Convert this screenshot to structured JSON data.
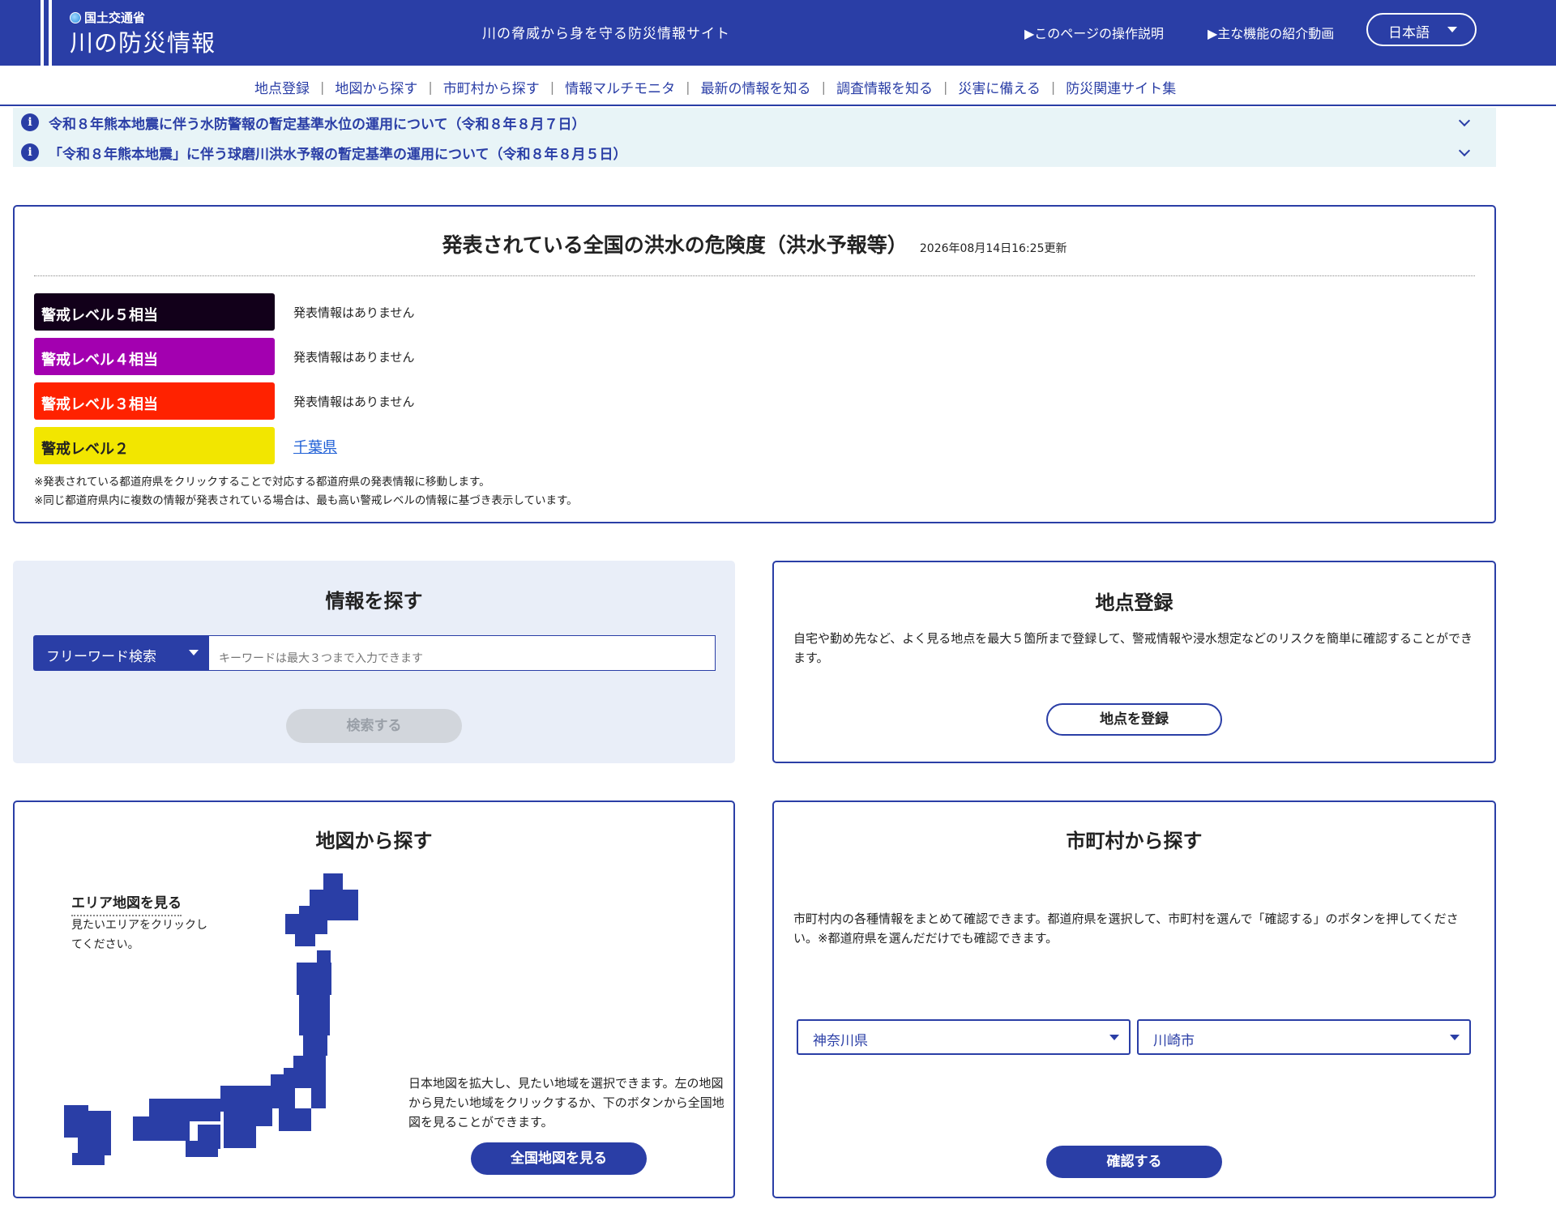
{
  "header": {
    "agency": "国土交通省",
    "site_title": "川の防災情報",
    "tagline": "川の脅威から身を守る防災情報サイト",
    "links": [
      "▶このページの操作説明",
      "▶主な機能の紹介動画"
    ],
    "language": "日本語"
  },
  "nav": {
    "items": [
      "地点登録",
      "地図から探す",
      "市町村から探す",
      "情報マルチモニタ",
      "最新の情報を知る",
      "調査情報を知る",
      "災害に備える",
      "防災関連サイト集"
    ]
  },
  "notices": [
    "令和８年熊本地震に伴う水防警報の暫定基準水位の運用について（令和８年８月７日）",
    "「令和８年熊本地震」に伴う球磨川洪水予報の暫定基準の運用について（令和８年８月５日）"
  ],
  "flood": {
    "title": "発表されている全国の洪水の危険度（洪水予報等）",
    "updated": "2026年08月14日16:25更新",
    "levels": [
      {
        "label": "警戒レベル５相当",
        "status": "発表情報はありません",
        "color": "#12001a"
      },
      {
        "label": "警戒レベル４相当",
        "status": "発表情報はありません",
        "color": "#a300b0"
      },
      {
        "label": "警戒レベル３相当",
        "status": "発表情報はありません",
        "color": "#ff2200"
      },
      {
        "label": "警戒レベル２",
        "status": "千葉県",
        "color": "#f2e600"
      }
    ],
    "notes": [
      "※発表されている都道府県をクリックすることで対応する都道府県の発表情報に移動します。",
      "※同じ都道府県内に複数の情報が発表されている場合は、最も高い警戒レベルの情報に基づき表示しています。"
    ]
  },
  "search": {
    "title": "情報を探す",
    "mode": "フリーワード検索",
    "placeholder": "キーワードは最大３つまで入力できます",
    "button": "検索する"
  },
  "register": {
    "title": "地点登録",
    "description": "自宅や勤め先など、よく見る地点を最大５箇所まで登録して、警戒情報や浸水想定などのリスクを簡単に確認することができます。",
    "button": "地点を登録"
  },
  "map": {
    "title": "地図から探す",
    "area_label": "エリア地図を見る",
    "area_hint": "見たいエリアをクリックしてください。",
    "description": "日本地図を拡大し、見たい地域を選択できます。左の地図から見たい地域をクリックするか、下のボタンから全国地図を見ることができます。",
    "button": "全国地図を見る"
  },
  "municipality": {
    "title": "市町村から探す",
    "description": "市町村内の各種情報をまとめて確認できます。都道府県を選択して、市町村を選んで「確認する」のボタンを押してください。※都道府県を選んだだけでも確認できます。",
    "prefecture": "神奈川県",
    "city": "川崎市",
    "button": "確認する"
  },
  "colors": {
    "primary": "#2a3ea6",
    "notice_bg": "#e8f4f7",
    "search_bg": "#e9eef8"
  }
}
